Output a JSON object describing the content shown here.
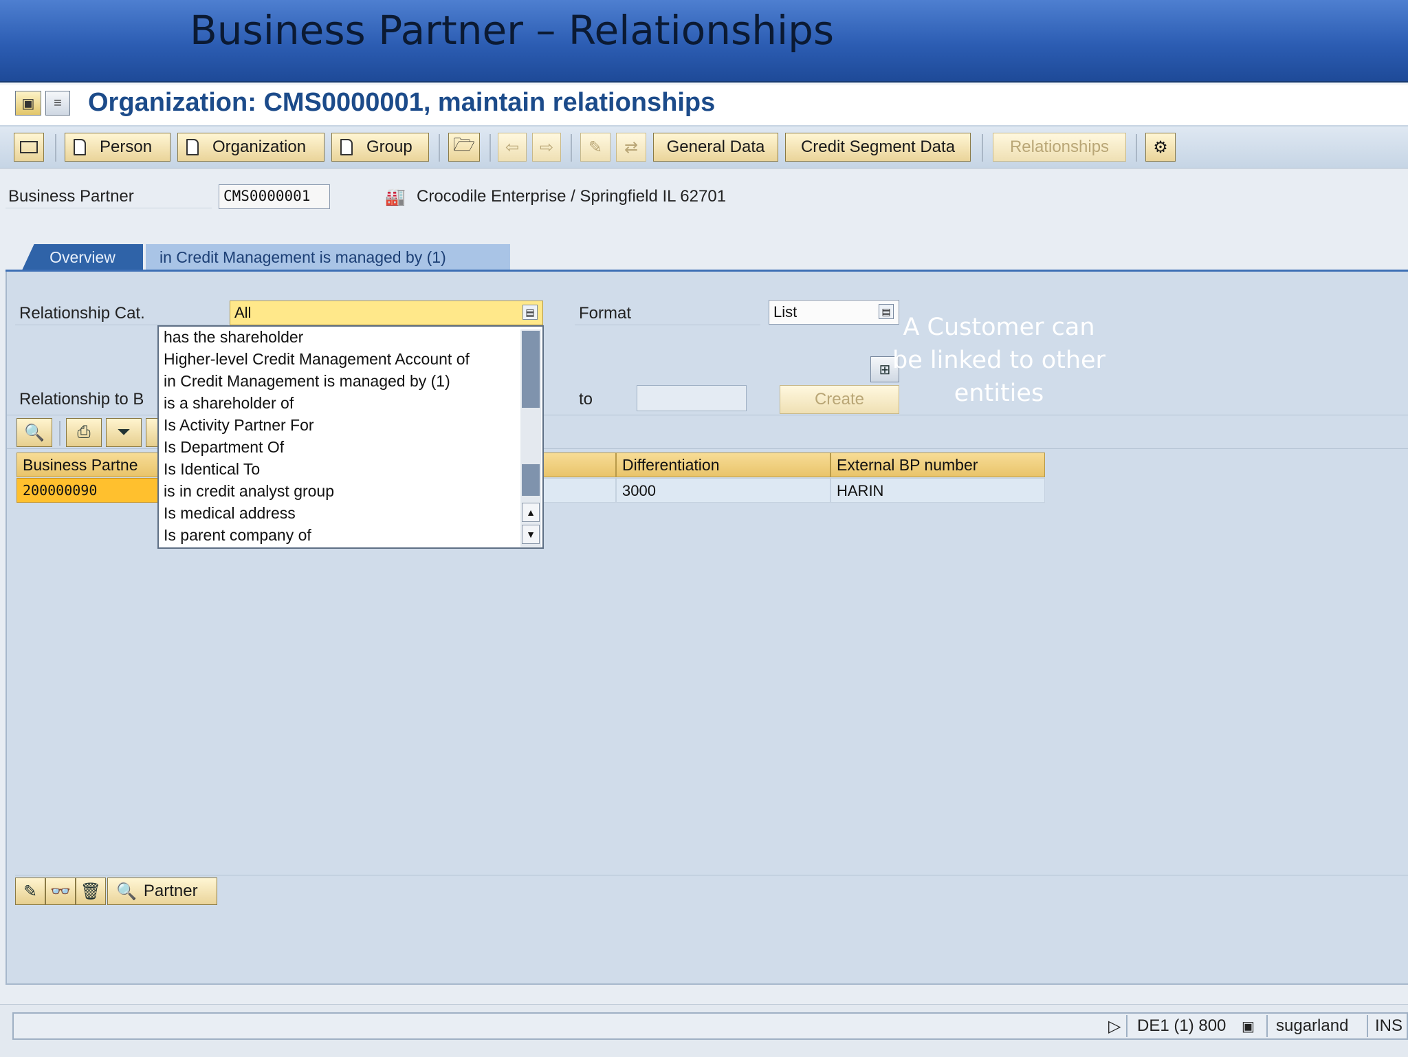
{
  "slide": {
    "title": "Business Partner – Relationships"
  },
  "window": {
    "title": "Organization: CMS0000001, maintain relationships"
  },
  "toolbar": {
    "person": "Person",
    "organization": "Organization",
    "group": "Group",
    "general_data": "General Data",
    "credit_segment_data": "Credit Segment Data",
    "relationships": "Relationships"
  },
  "header_fields": {
    "bp_label": "Business Partner",
    "bp_value": "CMS0000001",
    "bp_description": "Crocodile Enterprise / Springfield IL 62701"
  },
  "tabs": [
    {
      "label": "Overview",
      "active": true
    },
    {
      "label": "in Credit Management is managed by (1)",
      "active": false
    }
  ],
  "form": {
    "rel_cat_label": "Relationship Cat.",
    "rel_cat_value": "All",
    "format_label": "Format",
    "format_value": "List",
    "rel_to_label": "Relationship to B",
    "to_label": "to",
    "to_value": "",
    "create_label": "Create"
  },
  "dropdown": {
    "items": [
      "has the shareholder",
      "Higher-level Credit Management Account of",
      "in Credit Management is managed by (1)",
      "is a shareholder of",
      "Is Activity Partner For",
      "Is Department Of",
      "Is Identical To",
      "is in credit analyst group",
      "Is medical address",
      "Is parent company of"
    ]
  },
  "table": {
    "headers": [
      "Business Partne",
      "Differentiation",
      "External BP number"
    ],
    "rows": [
      [
        "200000090",
        "3000",
        "HARIN"
      ]
    ]
  },
  "bottom_toolbar": {
    "partner_label": "Partner"
  },
  "annotation": {
    "text": "A Customer can be linked to other entities"
  },
  "status_bar": {
    "system": "DE1 (1) 800",
    "server": "sugarland",
    "mode": "INS"
  },
  "colors": {
    "accent": "#1c4b8a",
    "header_blue": "#2c5db3",
    "button_yellow": "#ead49a",
    "field_yellow": "#ffe88a",
    "tab_active": "#2f63a8"
  }
}
